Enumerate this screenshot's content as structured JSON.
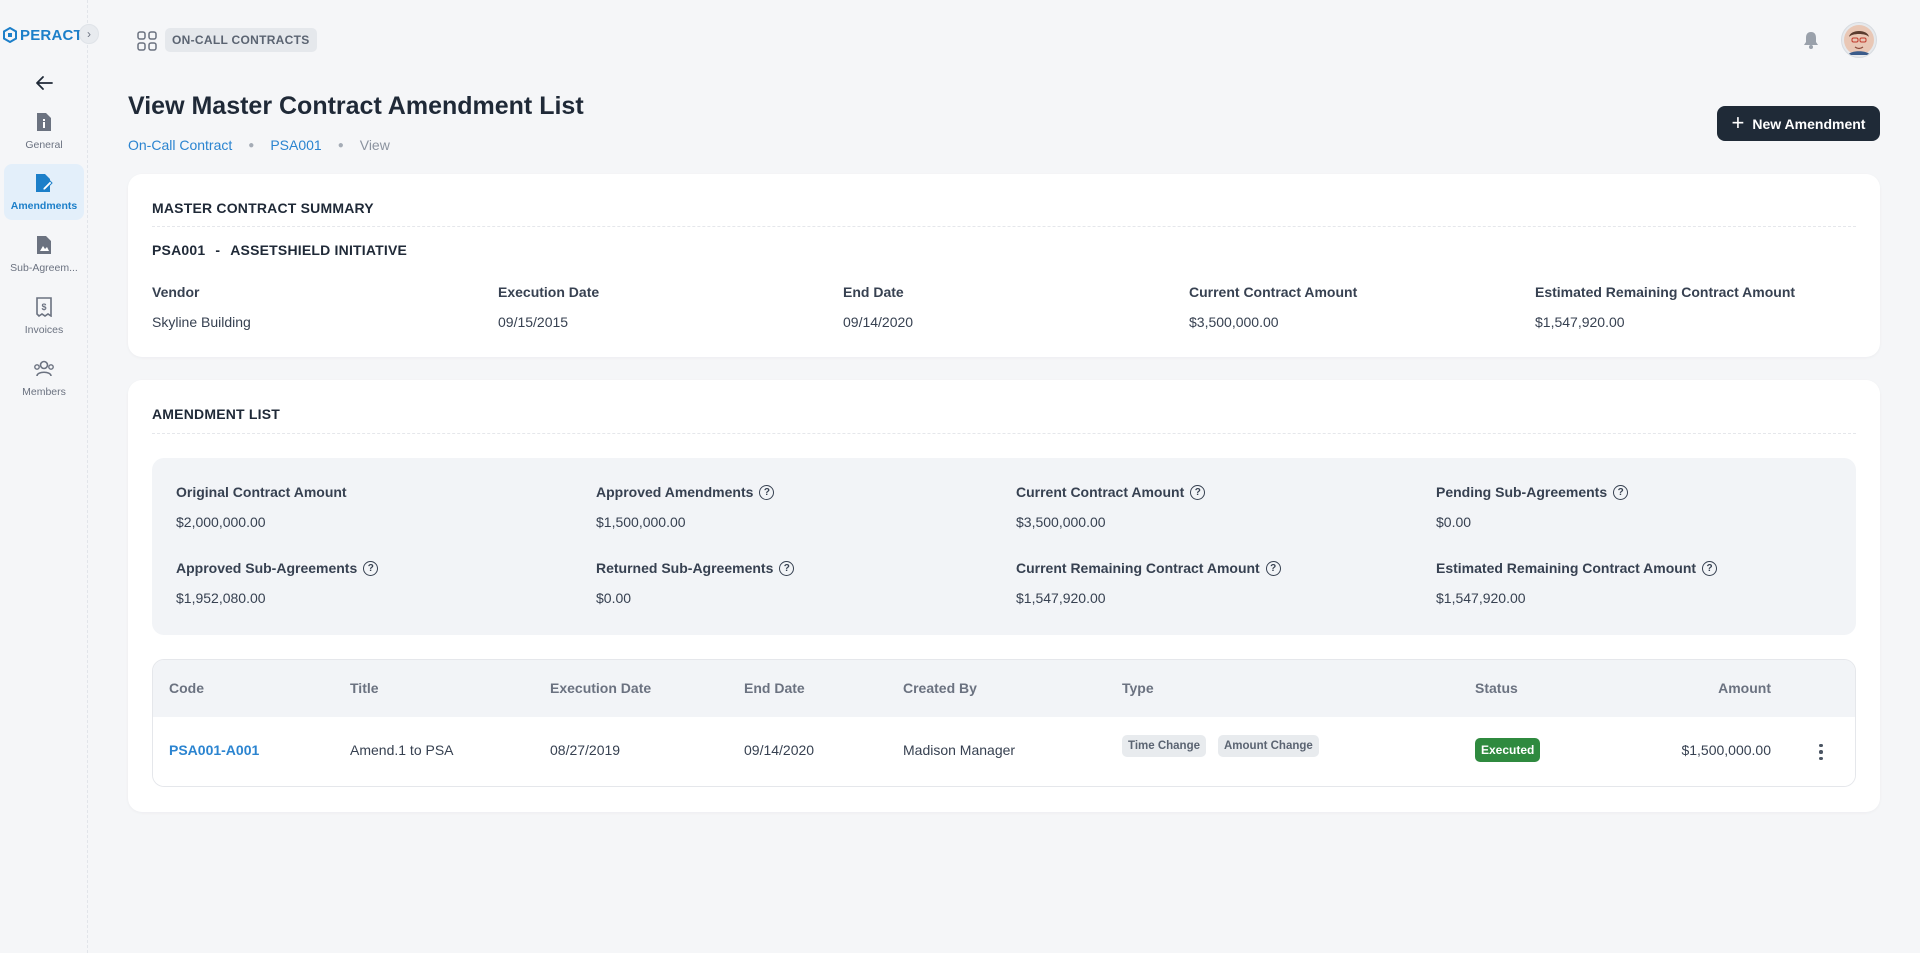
{
  "brand": {
    "name": "PERACT"
  },
  "sidebar": {
    "items": [
      {
        "label": "General",
        "icon": "document-info-icon"
      },
      {
        "label": "Amendments",
        "icon": "document-edit-icon"
      },
      {
        "label": "Sub-Agreem...",
        "icon": "document-image-icon"
      },
      {
        "label": "Invoices",
        "icon": "invoice-dollar-icon"
      },
      {
        "label": "Members",
        "icon": "members-icon"
      }
    ],
    "active": "Amendments"
  },
  "header": {
    "module": "ON-CALL CONTRACTS"
  },
  "page": {
    "title": "View Master Contract Amendment List",
    "breadcrumb": [
      "On-Call Contract",
      "PSA001",
      "View"
    ],
    "new_button": "New Amendment"
  },
  "summary": {
    "title": "MASTER CONTRACT SUMMARY",
    "code": "PSA001",
    "separator": "-",
    "name": "ASSETSHIELD INITIATIVE",
    "fields": [
      {
        "label": "Vendor",
        "value": "Skyline Building"
      },
      {
        "label": "Execution Date",
        "value": "09/15/2015"
      },
      {
        "label": "End Date",
        "value": "09/14/2020"
      },
      {
        "label": "Current Contract Amount",
        "value": "$3,500,000.00"
      },
      {
        "label": "Estimated Remaining Contract Amount",
        "value": "$1,547,920.00"
      }
    ]
  },
  "amendments": {
    "title": "AMENDMENT LIST",
    "stats": [
      {
        "label": "Original Contract Amount",
        "value": "$2,000,000.00",
        "help": false
      },
      {
        "label": "Approved Amendments",
        "value": "$1,500,000.00",
        "help": true
      },
      {
        "label": "Current Contract Amount",
        "value": "$3,500,000.00",
        "help": true
      },
      {
        "label": "Pending Sub-Agreements",
        "value": "$0.00",
        "help": true
      },
      {
        "label": "Approved Sub-Agreements",
        "value": "$1,952,080.00",
        "help": true
      },
      {
        "label": "Returned Sub-Agreements",
        "value": "$0.00",
        "help": true
      },
      {
        "label": "Current Remaining Contract Amount",
        "value": "$1,547,920.00",
        "help": true
      },
      {
        "label": "Estimated Remaining Contract Amount",
        "value": "$1,547,920.00",
        "help": true
      }
    ],
    "help_glyph": "?",
    "table": {
      "columns": [
        "Code",
        "Title",
        "Execution Date",
        "End Date",
        "Created By",
        "Type",
        "Status",
        "Amount"
      ],
      "rows": [
        {
          "code": "PSA001-A001",
          "title": "Amend.1 to PSA",
          "execution_date": "08/27/2019",
          "end_date": "09/14/2020",
          "created_by": "Madison Manager",
          "types": [
            "Time Change",
            "Amount Change"
          ],
          "status": "Executed",
          "amount": "$1,500,000.00"
        }
      ]
    }
  },
  "colors": {
    "brand": "#1c7fc9",
    "link": "#2b84d0",
    "primary_button": "#1f2a37",
    "status_executed": "#2f8a3f",
    "active_nav_bg": "#e3effa"
  }
}
